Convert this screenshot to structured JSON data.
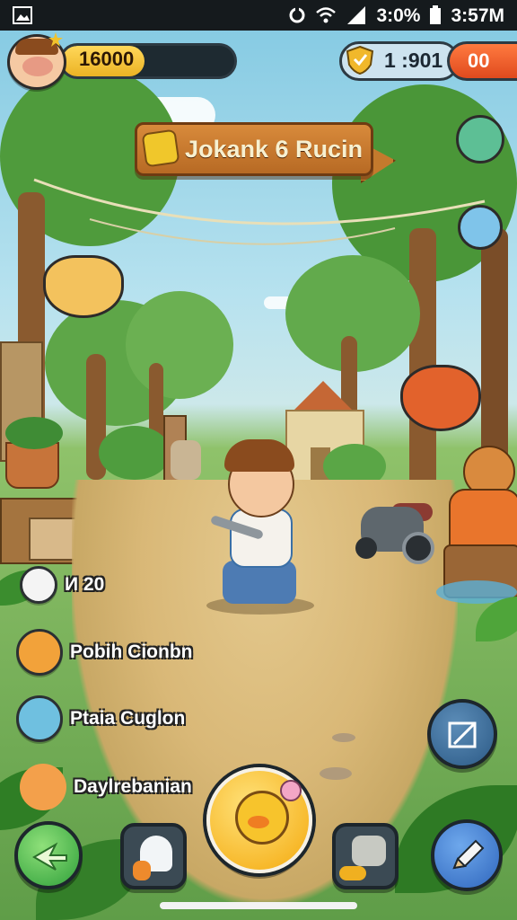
{
  "status_bar": {
    "battery_percent": "3:0%",
    "time": "3:57M"
  },
  "hud": {
    "coins": "16000",
    "coin_fill_percent": 48,
    "right_counter": "1 :901",
    "right_badge": "00"
  },
  "sign": {
    "title": "Jokank 6 Rucin"
  },
  "friends": [
    {
      "name": "И 20",
      "color": "#f4f4f4"
    },
    {
      "name": "Pobih Cionbn",
      "color": "#f2a23a"
    },
    {
      "name": "Ptaia Cuglon",
      "color": "#6fc0e0"
    },
    {
      "name": "Daylrebanian",
      "color": "#f3a04b"
    }
  ],
  "colors": {
    "accent_gold": "#f1b82b",
    "badge_orange": "#e85a25",
    "go_green": "#45c24a",
    "edit_blue": "#3a74c9"
  },
  "icons": {
    "go_button": "arrow-icon",
    "edit_button": "pencil-icon",
    "map_button": "map-icon",
    "center_button": "chick-icon"
  }
}
